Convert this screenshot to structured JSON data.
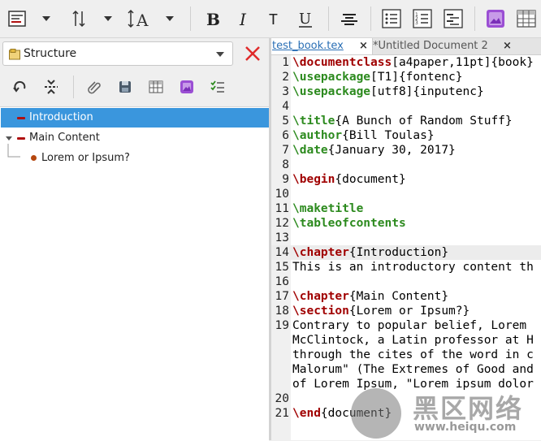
{
  "sidebar": {
    "structure_label": "Structure",
    "tree": [
      {
        "label": "Introduction",
        "selected": true
      },
      {
        "label": "Main Content",
        "selected": false
      },
      {
        "label": "Lorem or Ipsum?",
        "selected": false
      }
    ]
  },
  "editor": {
    "tabs": [
      {
        "label": "test_book.tex",
        "close": "×"
      },
      {
        "label": "*Untitled Document 2",
        "close": "×"
      }
    ],
    "lines": [
      {
        "n": "1",
        "cmd": "\\documentclass",
        "cls": "k",
        "rest": "[a4paper,11pt]{book}"
      },
      {
        "n": "2",
        "cmd": "\\usepackage",
        "cls": "g",
        "rest": "[T1]{fontenc}"
      },
      {
        "n": "3",
        "cmd": "\\usepackage",
        "cls": "g",
        "rest": "[utf8]{inputenc}"
      },
      {
        "n": "4",
        "cmd": "",
        "cls": "",
        "rest": ""
      },
      {
        "n": "5",
        "cmd": "\\title",
        "cls": "g",
        "rest": "{A Bunch of Random Stuff}"
      },
      {
        "n": "6",
        "cmd": "\\author",
        "cls": "g",
        "rest": "{Bill Toulas}"
      },
      {
        "n": "7",
        "cmd": "\\date",
        "cls": "g",
        "rest": "{January 30, 2017}"
      },
      {
        "n": "8",
        "cmd": "",
        "cls": "",
        "rest": ""
      },
      {
        "n": "9",
        "cmd": "\\begin",
        "cls": "k",
        "rest": "{document}"
      },
      {
        "n": "10",
        "cmd": "",
        "cls": "",
        "rest": ""
      },
      {
        "n": "11",
        "cmd": "\\maketitle",
        "cls": "g",
        "rest": ""
      },
      {
        "n": "12",
        "cmd": "\\tableofcontents",
        "cls": "g",
        "rest": ""
      },
      {
        "n": "13",
        "cmd": "",
        "cls": "",
        "rest": ""
      },
      {
        "n": "14",
        "cmd": "\\chapter",
        "cls": "k",
        "rest": "{Introduction}"
      },
      {
        "n": "15",
        "cmd": "",
        "cls": "",
        "rest": "This is an introductory content th"
      },
      {
        "n": "16",
        "cmd": "",
        "cls": "",
        "rest": ""
      },
      {
        "n": "17",
        "cmd": "\\chapter",
        "cls": "k",
        "rest": "{Main Content}"
      },
      {
        "n": "18",
        "cmd": "\\section",
        "cls": "k",
        "rest": "{Lorem or Ipsum?}"
      },
      {
        "n": "19",
        "cmd": "",
        "cls": "",
        "rest": "Contrary to popular belief, Lorem"
      },
      {
        "n": "",
        "cmd": "",
        "cls": "",
        "rest": "McClintock, a Latin professor at H"
      },
      {
        "n": "",
        "cmd": "",
        "cls": "",
        "rest": "through the cites of the word in c"
      },
      {
        "n": "",
        "cmd": "",
        "cls": "",
        "rest": "Malorum\" (The Extremes of Good and"
      },
      {
        "n": "",
        "cmd": "",
        "cls": "",
        "rest": "of Lorem Ipsum, \"Lorem ipsum dolor"
      },
      {
        "n": "20",
        "cmd": "",
        "cls": "",
        "rest": ""
      },
      {
        "n": "21",
        "cmd": "\\end",
        "cls": "k",
        "rest": "{document}"
      }
    ]
  },
  "watermark": {
    "brand": "黑区网络",
    "url": "www.heiqu.com"
  },
  "colors": {
    "selection": "#3a96dd",
    "keyword": "#a00000",
    "command": "#2c8a1e"
  }
}
